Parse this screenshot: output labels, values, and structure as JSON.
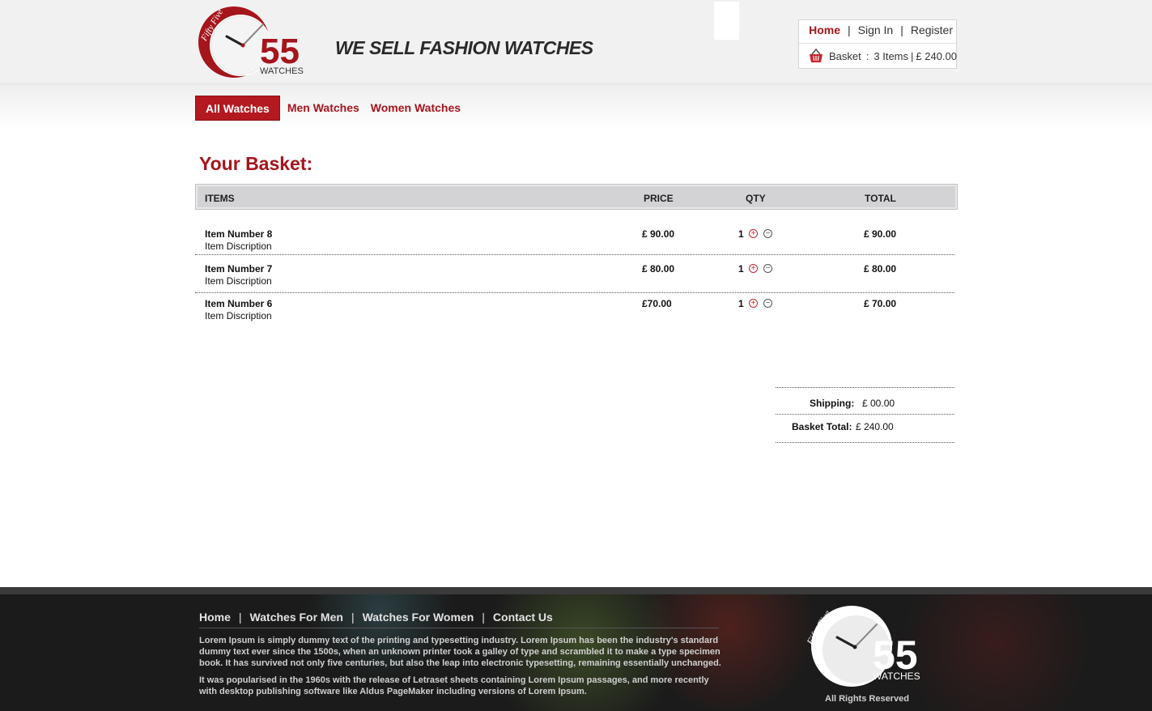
{
  "brand": {
    "logo_script": "Fifty Five",
    "logo_number": "55",
    "logo_word": "WATCHES",
    "tagline": "WE SELL FASHION WATCHES"
  },
  "account": {
    "home": "Home",
    "sign_in": "Sign In",
    "register": "Register",
    "separator": "|",
    "basket_label": "Basket",
    "basket_colon": ":",
    "basket_items": "3 Items",
    "basket_total": "£ 240.00",
    "basket_icon": "basket-icon"
  },
  "nav": {
    "items": [
      {
        "label": "All Watches",
        "active": true
      },
      {
        "label": "Men Watches",
        "active": false
      },
      {
        "label": "Women Watches",
        "active": false
      }
    ]
  },
  "basket": {
    "title": "Your Basket:",
    "columns": {
      "items": "ITEMS",
      "price": "PRICE",
      "qty": "QTY",
      "total": "TOTAL"
    },
    "rows": [
      {
        "name": "Item Number 8",
        "description": "Item Discription",
        "price": "£ 90.00",
        "qty": "1",
        "total": "£ 90.00"
      },
      {
        "name": "Item Number 7",
        "description": "Item Discription",
        "price": "£ 80.00",
        "qty": "1",
        "total": "£ 80.00"
      },
      {
        "name": "Item Number 6",
        "description": "Item Discription",
        "price": "£70.00",
        "qty": "1",
        "total": "£ 70.00"
      }
    ],
    "qty_plus_icon": "plus-circle-icon",
    "qty_minus_icon": "minus-circle-icon",
    "shipping_label": "Shipping:",
    "shipping_value": "£ 00.00",
    "basket_total_label": "Basket Total:",
    "basket_total_value": "£ 240.00"
  },
  "footer": {
    "links": [
      "Home",
      "Watches For Men",
      "Watches For Women",
      "Contact Us"
    ],
    "separator": "|",
    "paragraph1": "Lorem Ipsum is simply dummy text of the printing and typesetting industry. Lorem Ipsum has been the industry's standard dummy text ever since the 1500s, when an unknown printer took a galley of type and scrambled it to make a type specimen book. It has survived not only five centuries, but also the leap into electronic typesetting, remaining essentially unchanged.",
    "paragraph2": "It was popularised in the 1960s with the release of Letraset sheets containing Lorem Ipsum passages, and more recently with desktop publishing software like Aldus PageMaker including versions of Lorem Ipsum.",
    "rights": "All Rights Reserved"
  },
  "colors": {
    "brand_red": "#a5151c",
    "nav_active_bg": "#b3191f",
    "footer_bg": "#1b1b1b"
  }
}
